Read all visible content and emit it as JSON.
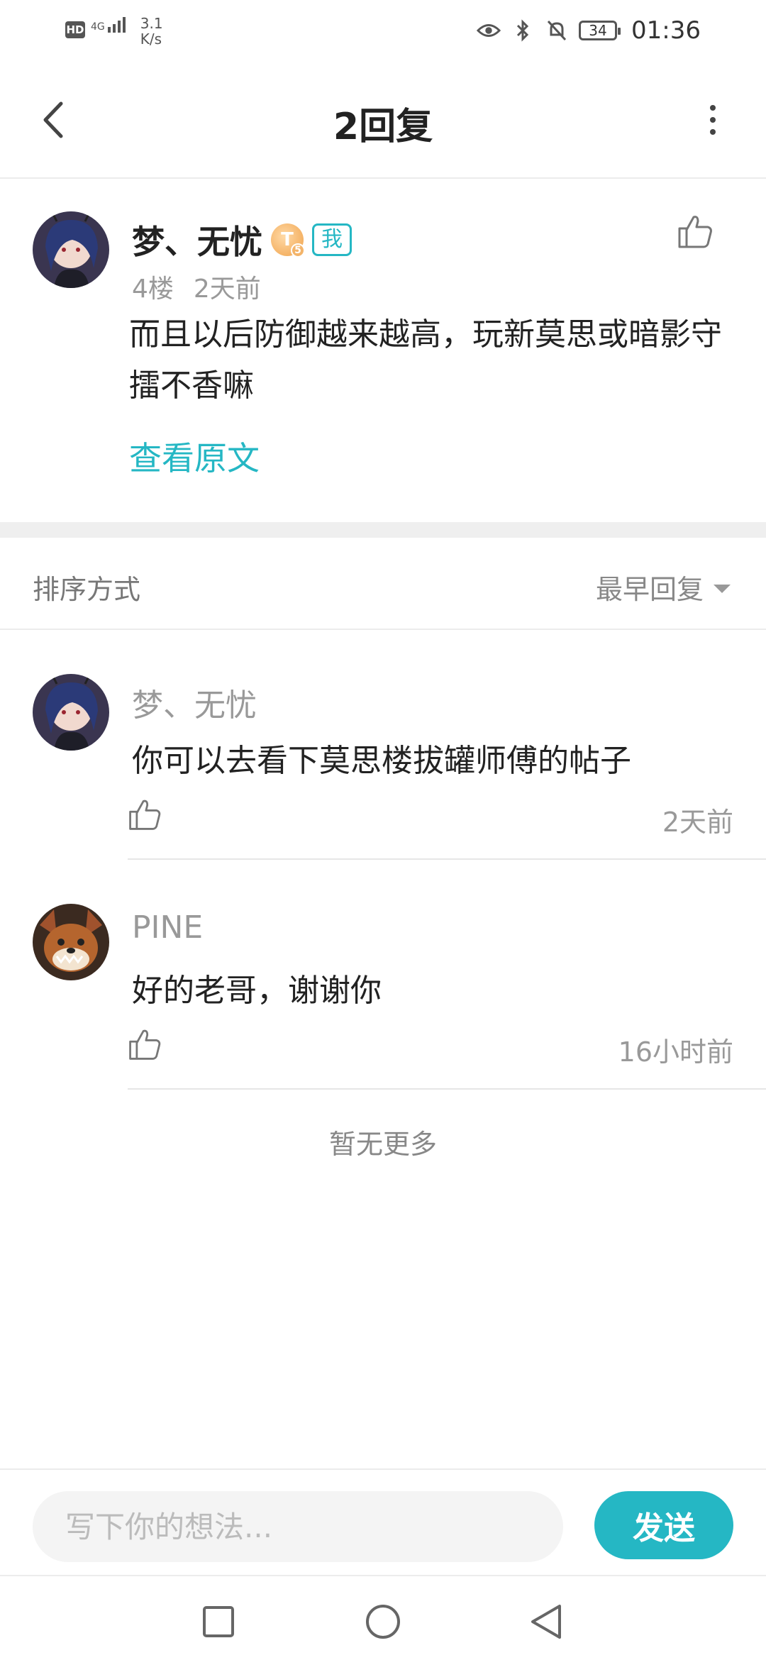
{
  "status_bar": {
    "hd": "HD",
    "network": "4G",
    "speed_value": "3.1",
    "speed_unit": "K/s",
    "battery": "34",
    "time": "01:36"
  },
  "header": {
    "title": "2回复"
  },
  "post": {
    "author": "梦、无忧",
    "level_badge": "T",
    "level_sub": "5",
    "me_tag": "我",
    "floor": "4楼",
    "time": "2天前",
    "content": "而且以后防御越来越高，玩新莫思或暗影守擂不香嘛",
    "view_original": "查看原文"
  },
  "sort": {
    "label": "排序方式",
    "selected": "最早回复"
  },
  "replies": [
    {
      "author": "梦、无忧",
      "text": "你可以去看下莫思楼拔罐师傅的帖子",
      "time": "2天前"
    },
    {
      "author": "PINE",
      "text": "好的老哥，谢谢你",
      "time": "16小时前"
    }
  ],
  "footer_note": "暂无更多",
  "composer": {
    "placeholder": "写下你的想法...",
    "send_label": "发送"
  },
  "colors": {
    "accent": "#25b7c4",
    "badge_gold": "#f0a24a"
  }
}
